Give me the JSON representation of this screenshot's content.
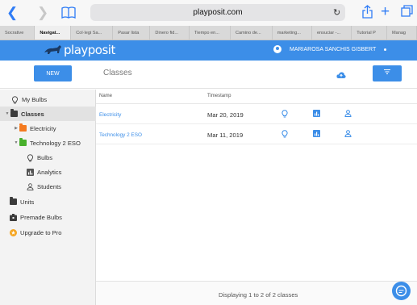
{
  "browser": {
    "url": "playposit.com",
    "tabs": [
      {
        "label": "Socrative",
        "active": false
      },
      {
        "label": "Navigat...",
        "active": true
      },
      {
        "label": "Col·legi Sa...",
        "active": false
      },
      {
        "label": "Pasar lista",
        "active": false
      },
      {
        "label": "Dinero fid...",
        "active": false
      },
      {
        "label": "Tiempo en...",
        "active": false
      },
      {
        "label": "Camino de...",
        "active": false
      },
      {
        "label": "marketing...",
        "active": false
      },
      {
        "label": "ensuciar -...",
        "active": false
      },
      {
        "label": "Tutorial P",
        "active": false
      },
      {
        "label": "Manag",
        "active": false
      }
    ]
  },
  "header": {
    "logo": "playposit",
    "user_name": "MARIAROSA SANCHIS GISBERT"
  },
  "toolbar": {
    "new_label": "NEW",
    "section_title": "Classes"
  },
  "sidebar": {
    "my_bulbs": "My Bulbs",
    "classes": "Classes",
    "electricity": "Electricity",
    "technology": "Technology 2 ESO",
    "bulbs": "Bulbs",
    "analytics": "Analytics",
    "students": "Students",
    "units": "Units",
    "premade": "Premade Bulbs",
    "upgrade": "Upgrade to Pro"
  },
  "table": {
    "columns": {
      "name": "Name",
      "timestamp": "Timestamp"
    },
    "rows": [
      {
        "name": "Electricity",
        "timestamp": "Mar 20, 2019"
      },
      {
        "name": "Technology 2 ESO",
        "timestamp": "Mar 11, 2019"
      }
    ]
  },
  "footer": {
    "status": "Displaying 1 to 2 of 2 classes"
  },
  "colors": {
    "brand_blue": "#3c8ee8",
    "folder_orange": "#f47a20",
    "folder_green": "#48b02c"
  }
}
